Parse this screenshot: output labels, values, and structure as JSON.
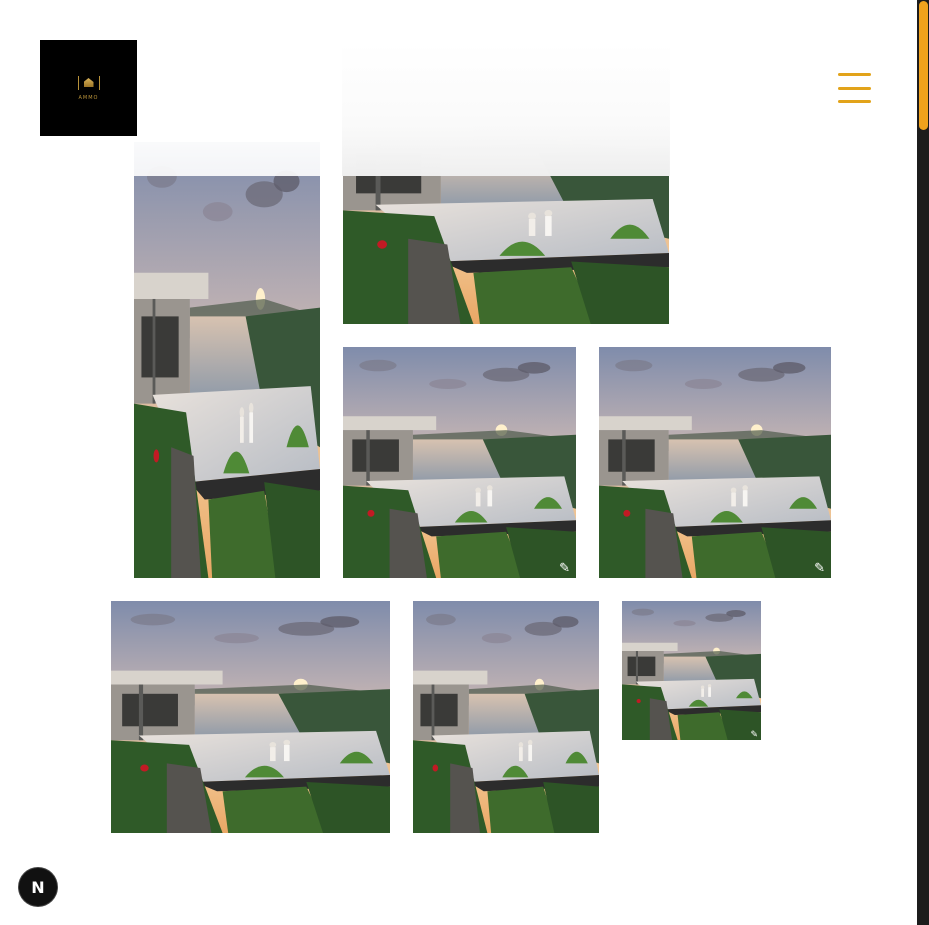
{
  "header": {
    "logo_text": "AMMO",
    "menu_icon": "hamburger-menu-icon",
    "accent_color": "#e2a31a"
  },
  "gallery": {
    "photos": [
      {
        "id": "p1",
        "subject": "villa-pool-sunset",
        "signature": ""
      },
      {
        "id": "p2",
        "subject": "villa-pool-sunset",
        "signature": ""
      },
      {
        "id": "p3",
        "subject": "villa-pool-sunset",
        "signature": "✎"
      },
      {
        "id": "p4",
        "subject": "villa-pool-sunset",
        "signature": "✎"
      },
      {
        "id": "p5",
        "subject": "villa-pool-sunset",
        "signature": ""
      },
      {
        "id": "p6",
        "subject": "villa-pool-sunset",
        "signature": ""
      },
      {
        "id": "p7",
        "subject": "villa-pool-sunset",
        "signature": "✎"
      }
    ]
  },
  "dev_badge": {
    "label": "N"
  },
  "colors": {
    "scroll_thumb": "#f0a21d",
    "scroll_track": "#1c1c1c",
    "logo_gold": "#b8923a"
  }
}
